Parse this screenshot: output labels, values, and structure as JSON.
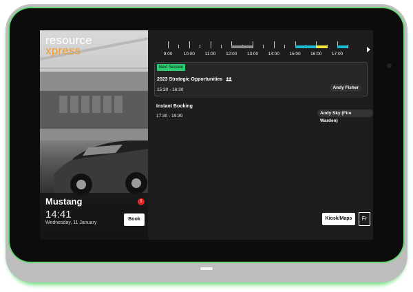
{
  "brand": {
    "line1": "resource",
    "line2": "xpress"
  },
  "room": {
    "name": "Mustang",
    "time": "14:41",
    "date": "Wednesday, 11 January",
    "alert_icon": "exclamation-icon"
  },
  "buttons": {
    "book": "Book",
    "kiosk": "Kiosk/Maps",
    "language": "Fr"
  },
  "timeline": {
    "labels": [
      "9:00",
      "10:00",
      "11:00",
      "12:00",
      "13:00",
      "14:00",
      "15:00",
      "16:00",
      "17:00"
    ],
    "segments": [
      {
        "start": "12:00",
        "end": "13:00",
        "color": "#8c8c8c"
      },
      {
        "start": "15:00",
        "end": "15:30",
        "color": "#19b9d1"
      },
      {
        "start": "15:30",
        "end": "16:00",
        "color": "#19b9d1"
      },
      {
        "start": "16:00",
        "end": "16:30",
        "color": "#f7e43a"
      },
      {
        "start": "17:00",
        "end": "17:30",
        "color": "#19b9d1"
      }
    ]
  },
  "next_session": {
    "badge": "Next Session",
    "title": "2023 Strategic Opportunities",
    "time": "15:30 - 16:30",
    "organizer": "Andy Fisher",
    "icon": "people-icon"
  },
  "other_session": {
    "title": "Instant Booking",
    "time": "17:30 - 19:30",
    "organizer": "Andy Sky (Fire Warden)"
  },
  "colors": {
    "accent_green": "#2ecc71",
    "logo_orange": "#f29a2b"
  }
}
